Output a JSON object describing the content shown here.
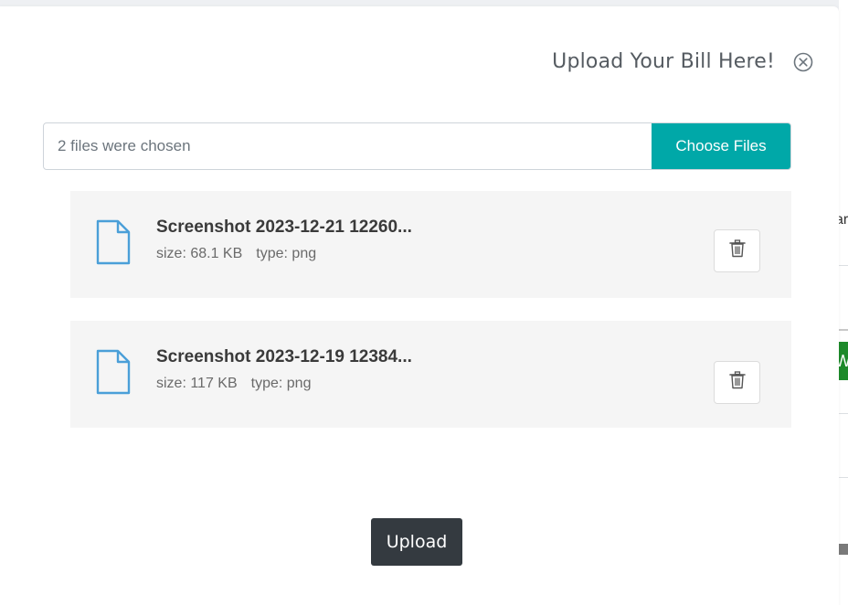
{
  "modal": {
    "title": "Upload Your Bill Here!",
    "close_icon": "close-circle-icon"
  },
  "file_input": {
    "status_text": "2 files were chosen",
    "button_label": "Choose Files",
    "button_color": "#00a8a8"
  },
  "files": [
    {
      "name": "Screenshot 2023-12-21 12260...",
      "size": "size: 68.1 KB",
      "type": "type: png",
      "icon": "file-icon",
      "delete_icon": "trash-icon"
    },
    {
      "name": "Screenshot 2023-12-19 12384...",
      "size": "size: 117 KB",
      "type": "type: png",
      "icon": "file-icon",
      "delete_icon": "trash-icon"
    }
  ],
  "upload_button": {
    "label": "Upload",
    "color": "#343a40"
  },
  "background": {
    "partial_text_1": "ar",
    "partial_text_2": "W"
  }
}
